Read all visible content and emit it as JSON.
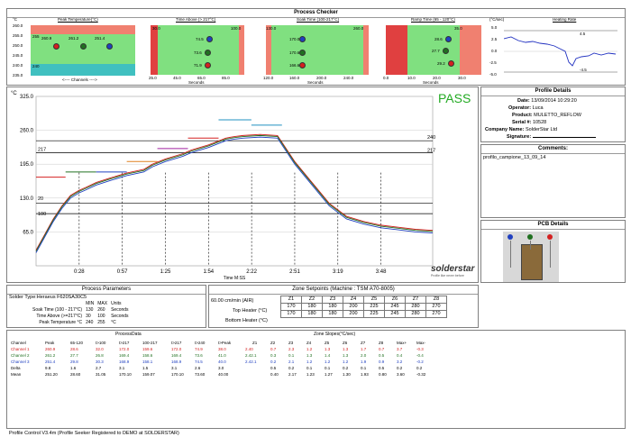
{
  "header": {
    "title": "Process Checker"
  },
  "mini_charts": [
    {
      "title": "Peak Temperature(°C)",
      "unit": "°C",
      "yticks": [
        "260.0",
        "255.0",
        "250.0",
        "245.0",
        "240.0",
        "235.0"
      ],
      "values": [
        "260.9",
        "261.2",
        "251.4"
      ],
      "limits": [
        "255",
        "240"
      ],
      "xlabel": "<---- Channels ---->"
    },
    {
      "title": "Time Above (> 217°C)",
      "xticks": [
        "25.0",
        "45.0",
        "65.0",
        "85.0"
      ],
      "values": [
        "74.5",
        "73.6",
        "71.9"
      ],
      "limits": [
        "30.0",
        "100.0"
      ],
      "xlabel": "Seconds"
    },
    {
      "title": "Soak Time (100-217°C)",
      "xticks": [
        "120.0",
        "160.0",
        "200.0",
        "240.0"
      ],
      "values": [
        "170.0",
        "170.6",
        "166.6"
      ],
      "limits": [
        "130.0",
        "260.0"
      ],
      "xlabel": "Seconds"
    },
    {
      "title": "Ramp Time (65 - 120°C)",
      "xticks": [
        "0.0",
        "10.0",
        "20.0",
        "30.0"
      ],
      "values": [
        "28.6",
        "27.7",
        "29.2"
      ],
      "limits": [
        "35.0"
      ],
      "xlabel": "Seconds"
    },
    {
      "title": "Heating Rate",
      "unit": "(°C/sec)",
      "yticks": [
        "5.0",
        "2.5",
        "0.0",
        "-2.5",
        "-5.0"
      ],
      "limits": [
        "4.5",
        "-4.5"
      ]
    }
  ],
  "main_chart": {
    "unit": "°C",
    "xlabel": "Time M:SS",
    "pass_text": "PASS",
    "logo": "solderstar",
    "logo_tag": "Profile like never before"
  },
  "chart_data": {
    "type": "line",
    "x": [
      0,
      10,
      20,
      30,
      40,
      50,
      57,
      70,
      85,
      105,
      125,
      135,
      150,
      170,
      180,
      200,
      220,
      230,
      240,
      260,
      280,
      300,
      320,
      340,
      360,
      380,
      400,
      420,
      440,
      460
    ],
    "series": [
      {
        "values": [
          30,
          60,
          90,
          115,
          135,
          145,
          150,
          160,
          168,
          178,
          185,
          195,
          205,
          215,
          222,
          232,
          245,
          248,
          250,
          252,
          250,
          200,
          160,
          120,
          95,
          85,
          78,
          74,
          70,
          68
        ]
      }
    ],
    "xticks": [
      "0:28",
      "0:57",
      "1:25",
      "1:54",
      "2:22",
      "2:51",
      "3:19",
      "3:48"
    ],
    "yticks": [
      "325.0",
      "260.0",
      "195.0",
      "130.0",
      "65.0"
    ],
    "ylim": [
      0,
      325
    ],
    "annotations": [
      "217",
      "100",
      "240",
      "217",
      "20"
    ]
  },
  "profile_details": {
    "title": "Profile Details",
    "date_label": "Date:",
    "date": "13/09/2014",
    "time": "10:29:20",
    "operator_label": "Operator:",
    "operator": "Luca",
    "product_label": "Product:",
    "product": "MULETTO_REFLOW",
    "serial_label": "Serial #:",
    "serial": "10528",
    "company_label": "Company Name:",
    "company": "SolderStar Ltd",
    "signature_label": "Signature:"
  },
  "comments": {
    "title": "Comments:",
    "text": "profilo_campione_13_09_14"
  },
  "pcb": {
    "title": "PCB Details"
  },
  "process_params": {
    "title": "Process Parameters",
    "solder": "Solder Type:Heraeus F620SA30C5",
    "head": [
      "MIN",
      "MAX",
      "Units"
    ],
    "rows": [
      {
        "name": "Soak Time (100 - 217°C)",
        "min": "130",
        "max": "260",
        "units": "Seconds"
      },
      {
        "name": "Time Above (>=217°C)",
        "min": "30",
        "max": "100",
        "units": "Seconds"
      },
      {
        "name": "Peak Temperature °C",
        "min": "240",
        "max": "255",
        "units": "°C"
      }
    ]
  },
  "zone_setpoints": {
    "title": "Zone Setpoints (Machine : TSM A70-8005)",
    "speed": "60.00 cm/min (AIR)",
    "zones": [
      "Z1",
      "Z2",
      "Z3",
      "Z4",
      "Z5",
      "Z6",
      "Z7",
      "Z8"
    ],
    "rows": [
      {
        "name": "Top Heater (°C)",
        "values": [
          "170",
          "180",
          "180",
          "200",
          "225",
          "245",
          "280",
          "270"
        ]
      },
      {
        "name": "Bottom Heater (°C)",
        "values": [
          "170",
          "180",
          "180",
          "200",
          "225",
          "245",
          "280",
          "270"
        ]
      }
    ]
  },
  "process_data": {
    "title": "ProcessData",
    "zone_title": "Zone Slopes(°C/sec)",
    "head": [
      "Channel",
      "Peak",
      "65-120",
      "t>100",
      "t>217",
      "100-217",
      "t>217",
      "t>240",
      "t>Peak",
      "Z1",
      "Z2",
      "Z3",
      "Z4",
      "Z5",
      "Z6",
      "Z7",
      "Z8",
      "Max+",
      "Max-"
    ],
    "rows": [
      {
        "name": "Channel 1",
        "values": [
          "260.9",
          "28.6",
          "32.0",
          "172.0",
          "159.6",
          "172.0",
          "74.9",
          "38.0",
          "2.40",
          "0.7",
          "2.3",
          "1.2",
          "1.3",
          "1.3",
          "1.7",
          "0.7",
          "3.7",
          "-0.3"
        ]
      },
      {
        "name": "Channel 2",
        "values": [
          "261.2",
          "27.7",
          "26.8",
          "169.4",
          "158.6",
          "169.4",
          "73.6",
          "41.0",
          "2.42.1",
          "0.3",
          "0.1",
          "1.3",
          "1.4",
          "1.3",
          "2.0",
          "0.5",
          "0.4",
          "-0.4"
        ]
      },
      {
        "name": "Channel 3",
        "values": [
          "251.4",
          "29.8",
          "30.3",
          "168.9",
          "158.1",
          "168.9",
          "74.5",
          "40.0",
          "2.42.1",
          "0.2",
          "2.1",
          "1.2",
          "1.2",
          "1.2",
          "1.9",
          "0.9",
          "3.2",
          "-0.2"
        ]
      },
      {
        "name": "Delta",
        "values": [
          "9.8",
          "1.6",
          "2.7",
          "3.1",
          "1.5",
          "3.1",
          "2.6",
          "3.0",
          "",
          "0.5",
          "0.2",
          "0.1",
          "0.1",
          "0.2",
          "0.1",
          "0.5",
          "0.2",
          "0.2"
        ]
      },
      {
        "name": "Mean",
        "values": [
          "251.20",
          "28.60",
          "31.05",
          "170.10",
          "159.07",
          "170.10",
          "73.60",
          "40.00",
          "",
          "0.40",
          "2.17",
          "1.23",
          "1.27",
          "1.30",
          "1.93",
          "0.80",
          "3.60",
          "-0.32"
        ]
      }
    ]
  },
  "footer": {
    "text": "Profile Control V3.4m (Profile Seeker Registered to DEMO at SOLDERSTAR)"
  },
  "colors": {
    "ch1": "#d42020",
    "ch2": "#207020",
    "ch3": "#2040c0",
    "pass": "#22aa22"
  }
}
